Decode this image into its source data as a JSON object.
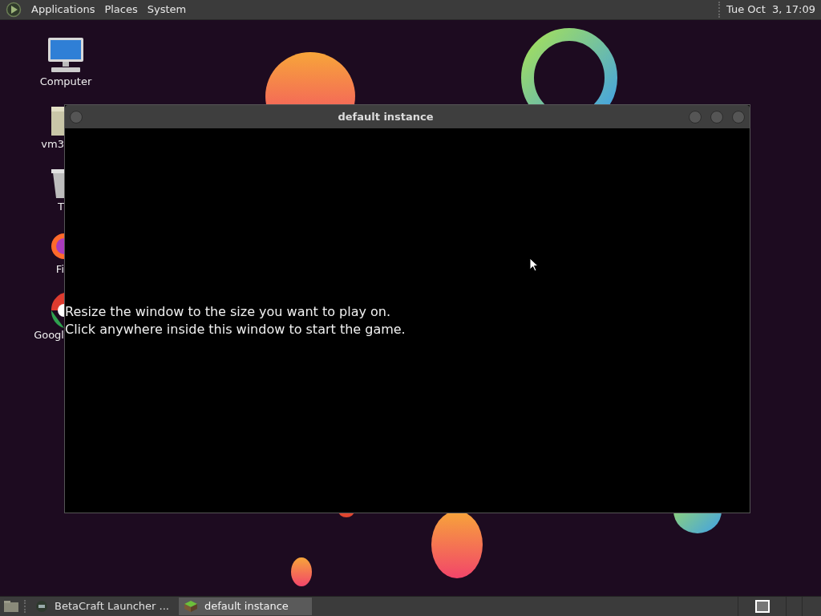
{
  "top_panel": {
    "menus": [
      "Applications",
      "Places",
      "System"
    ],
    "clock": "Tue Oct  3, 17:09"
  },
  "desktop_icons": [
    {
      "kind": "computer",
      "label": "Computer"
    },
    {
      "kind": "folder",
      "label": "vm3"
    },
    {
      "kind": "trash",
      "label": "T"
    },
    {
      "kind": "firefox",
      "label": "Fi"
    },
    {
      "kind": "chrome",
      "label": "Googl"
    }
  ],
  "window": {
    "title": "default instance",
    "message": [
      "Resize the window to the size you want to play on.",
      "Click anywhere inside this window to start the game."
    ]
  },
  "taskbar": {
    "tasks": [
      {
        "kind": "launcher",
        "label": "BetaCraft Launcher ...",
        "selected": false
      },
      {
        "kind": "block",
        "label": "default instance",
        "selected": true
      }
    ]
  }
}
